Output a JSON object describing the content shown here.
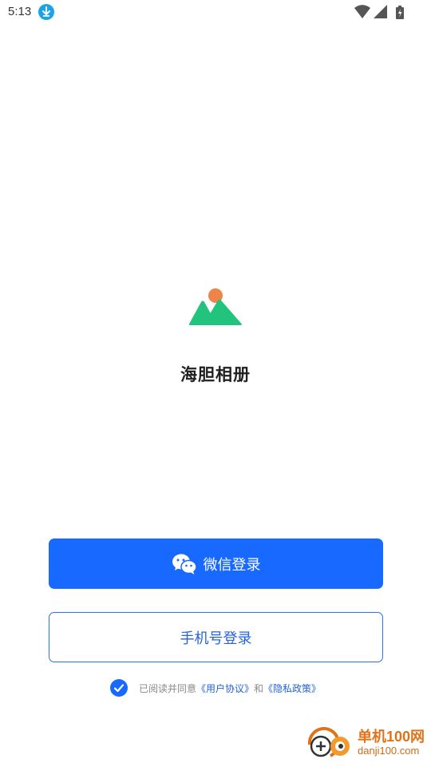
{
  "status_bar": {
    "time": "5:13",
    "icons": [
      "download-icon",
      "wifi-icon",
      "signal-icon",
      "battery-icon"
    ]
  },
  "app": {
    "title": "海胆相册",
    "logo_icon": "mountain-sun-logo",
    "logo_colors": {
      "mountain": "#22c47d",
      "sun": "#f0834a"
    }
  },
  "login": {
    "wechat_label": "微信登录",
    "wechat_icon": "wechat-icon",
    "phone_label": "手机号登录"
  },
  "agreement": {
    "checked": true,
    "prefix": "已阅读并同意",
    "user_agreement": "《用户协议》",
    "joiner": "和",
    "privacy_policy": "《隐私政策》"
  },
  "watermark": {
    "title": "单机100网",
    "domain": "danji100.com"
  },
  "colors": {
    "primary": "#1769ff",
    "link": "#2563d6",
    "background": "#ffffff"
  }
}
